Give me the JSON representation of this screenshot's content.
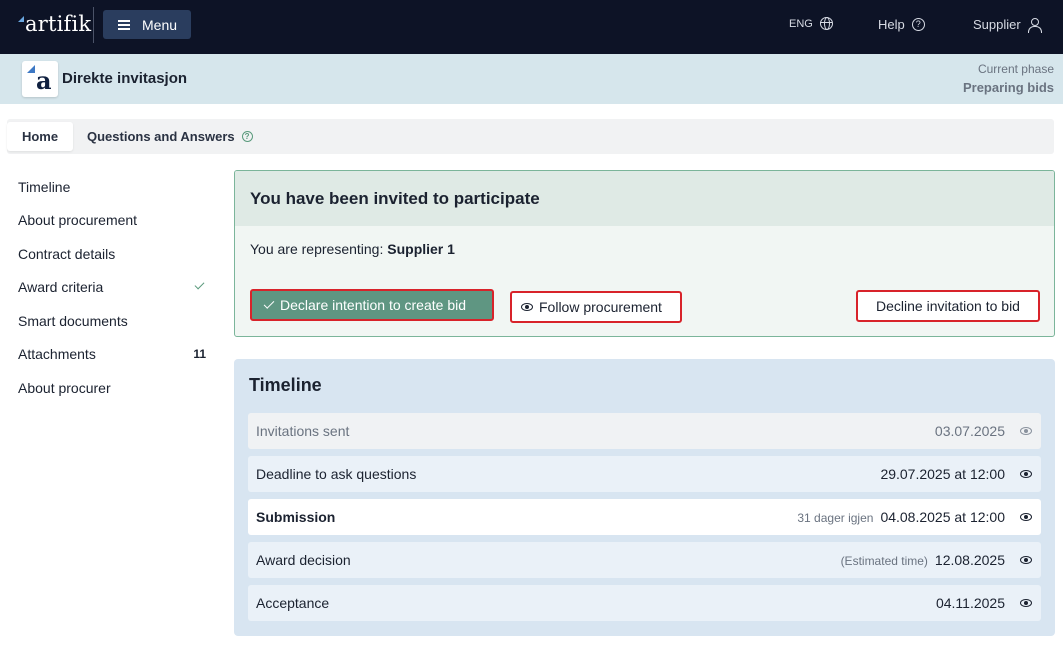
{
  "topbar": {
    "logo": "artifik",
    "menu_label": "Menu",
    "language": "ENG",
    "help_label": "Help",
    "user_label": "Supplier"
  },
  "project": {
    "title": "Direkte invitasjon",
    "phase_label": "Current phase",
    "phase_value": "Preparing bids"
  },
  "tabs": [
    {
      "label": "Home",
      "active": true
    },
    {
      "label": "Questions and Answers",
      "active": false
    }
  ],
  "sidebar": {
    "items": [
      {
        "label": "Timeline"
      },
      {
        "label": "About procurement"
      },
      {
        "label": "Contract details"
      },
      {
        "label": "Award criteria",
        "checked": true
      },
      {
        "label": "Smart documents"
      },
      {
        "label": "Attachments",
        "count": "11"
      },
      {
        "label": "About procurer"
      }
    ]
  },
  "invitation": {
    "heading": "You have been invited to participate",
    "representing_label": "You are representing:",
    "representing_value": "Supplier 1",
    "declare_label": "Declare intention to create bid",
    "follow_label": "Follow procurement",
    "decline_label": "Decline invitation to bid"
  },
  "timeline": {
    "title": "Timeline",
    "rows": [
      {
        "label": "Invitations sent",
        "note": "",
        "date": "03.07.2025"
      },
      {
        "label": "Deadline to ask questions",
        "note": "",
        "date": "29.07.2025 at 12:00"
      },
      {
        "label": "Submission",
        "note": "31 dager igjen",
        "date": "04.08.2025 at 12:00"
      },
      {
        "label": "Award decision",
        "note": "(Estimated time)",
        "date": "12.08.2025"
      },
      {
        "label": "Acceptance",
        "note": "",
        "date": "04.11.2025"
      }
    ]
  },
  "colors": {
    "topbar_bg": "#0d1326",
    "accent_green": "#5f9682",
    "highlight_red": "#d8232a",
    "timeline_bg": "#d8e5f1"
  }
}
